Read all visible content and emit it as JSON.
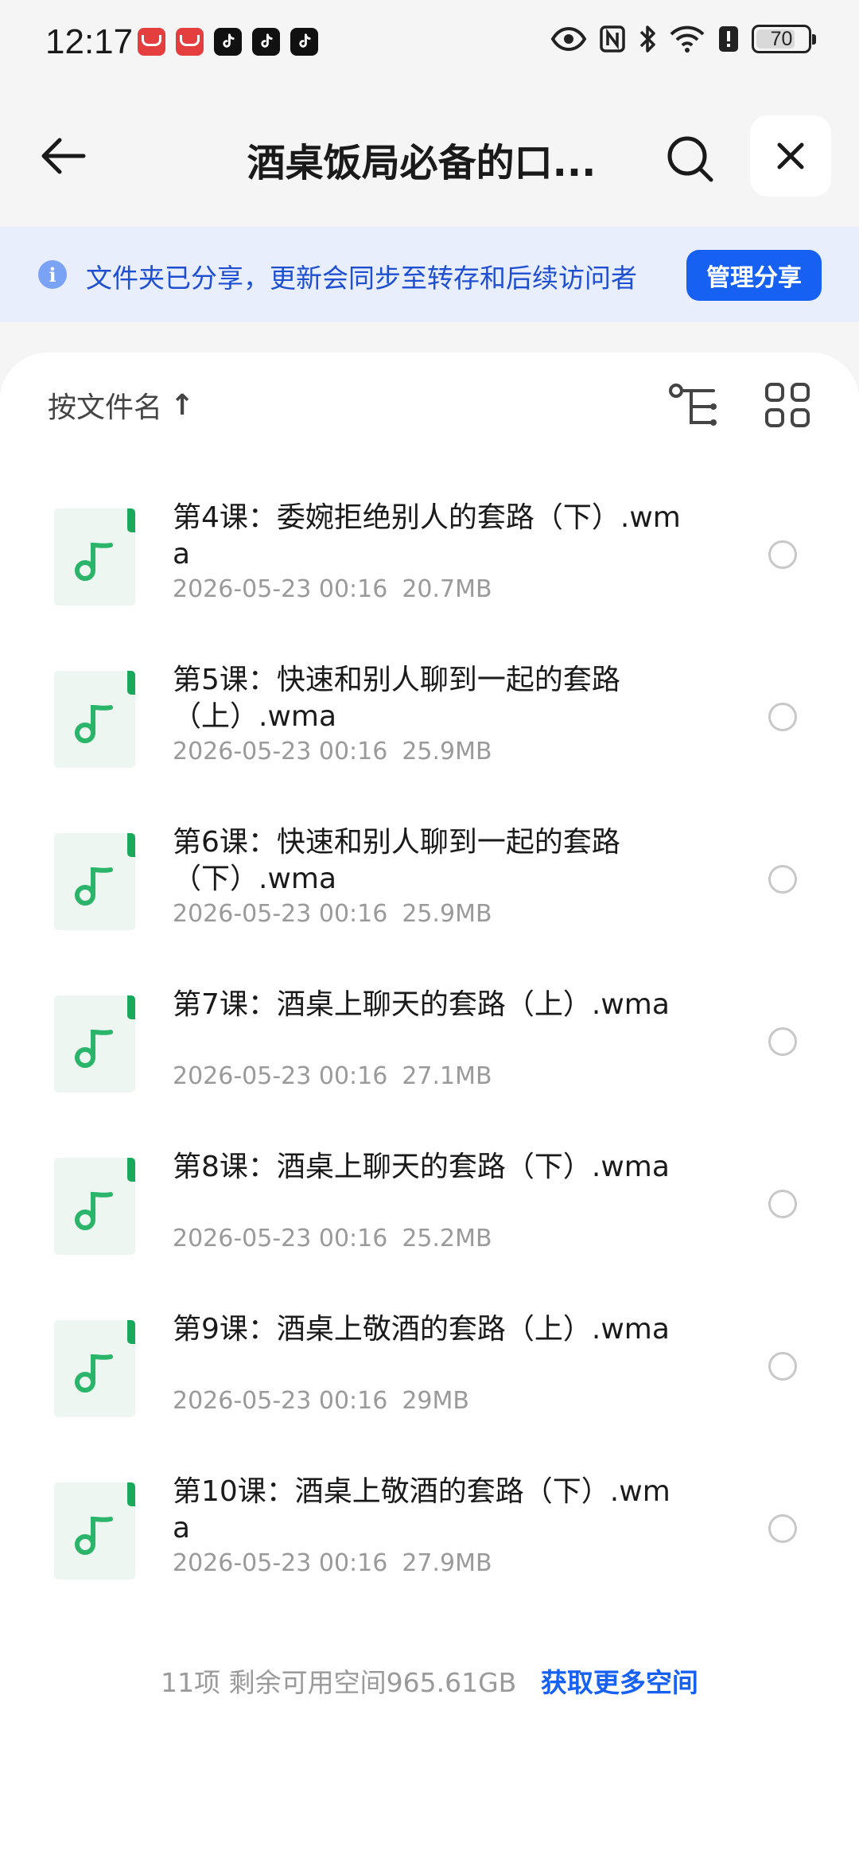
{
  "status_bar": {
    "time": "12:17",
    "battery": "70",
    "notification_icons": [
      "huawei-app-icon",
      "huawei-app-icon",
      "tiktok-icon",
      "tiktok-icon",
      "tiktok-icon"
    ],
    "system_icons": [
      "eye-icon",
      "nfc-icon",
      "bluetooth-icon",
      "wifi-icon",
      "alert-icon",
      "battery-icon"
    ]
  },
  "header": {
    "title": "酒桌饭局必备的口..."
  },
  "banner": {
    "text": "文件夹已分享，更新会同步至转存和后续访问者",
    "button": "管理分享",
    "color": "#1761f2"
  },
  "toolbar": {
    "sort_label": "按文件名",
    "sort_direction": "↑"
  },
  "files": [
    {
      "name": "第4课：委婉拒绝别人的套路（下）.wma",
      "date": "2026-05-23 00:16",
      "size": "20.7MB"
    },
    {
      "name": "第5课：快速和别人聊到一起的套路（上）.wma",
      "date": "2026-05-23 00:16",
      "size": "25.9MB"
    },
    {
      "name": "第6课：快速和别人聊到一起的套路（下）.wma",
      "date": "2026-05-23 00:16",
      "size": "25.9MB"
    },
    {
      "name": "第7课：酒桌上聊天的套路（上）.wma",
      "date": "2026-05-23 00:16",
      "size": "27.1MB"
    },
    {
      "name": "第8课：酒桌上聊天的套路（下）.wma",
      "date": "2026-05-23 00:16",
      "size": "25.2MB"
    },
    {
      "name": "第9课：酒桌上敬酒的套路（上）.wma",
      "date": "2026-05-23 00:16",
      "size": "29MB"
    },
    {
      "name": "第10课：酒桌上敬酒的套路（下）.wma",
      "date": "2026-05-23 00:16",
      "size": "27.9MB"
    }
  ],
  "footer": {
    "info": "11项 剩余可用空间965.61GB",
    "link": "获取更多空间"
  }
}
